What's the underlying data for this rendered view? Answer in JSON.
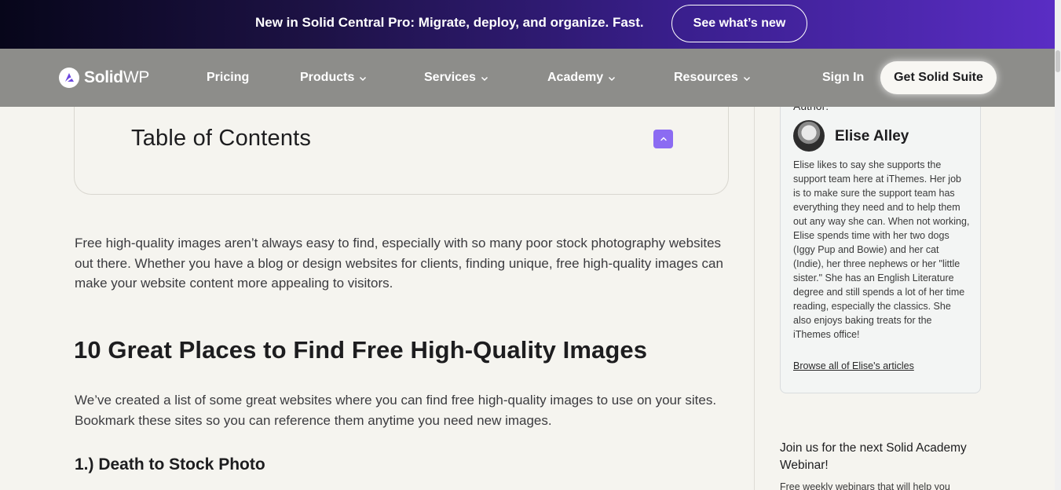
{
  "promo": {
    "text": "New in Solid Central Pro: Migrate, deploy, and organize. Fast.",
    "button": "See what’s new"
  },
  "nav": {
    "logo_bold": "Solid",
    "logo_light": "WP",
    "items": [
      {
        "label": "Pricing"
      },
      {
        "label": "Products"
      },
      {
        "label": "Services"
      },
      {
        "label": "Academy"
      },
      {
        "label": "Resources"
      }
    ],
    "signin": "Sign In",
    "cta": "Get Solid Suite"
  },
  "toc": {
    "title": "Table of Contents"
  },
  "article": {
    "intro": "Free high-quality images aren’t always easy to find, especially with so many poor stock photography websites out there. Whether you have a blog or design websites for clients, finding unique, free high-quality images can make your website content more appealing to visitors.",
    "heading": "10 Great Places to Find Free High-Quality Images",
    "list_intro": "We’ve created a list of some great websites where you can find free high-quality images to use on your sites. Bookmark these sites so you can reference them anytime you need new images.",
    "item1_heading": "1.)  Death to Stock Photo"
  },
  "author": {
    "label": "Author:",
    "name": "Elise Alley",
    "bio": "Elise likes to say she supports the support team here at iThemes. Her job is to make sure the support team has everything they need and to help them out any way she can. When not working, Elise spends time with her two dogs (Iggy Pup and Bowie) and her cat (Indie), her three nephews or her \"little sister.\" She has an English Literature degree and still spends a lot of her time reading, especially the classics. She also enjoys baking treats for the iThemes office!",
    "link": "Browse all of Elise's articles"
  },
  "sidebar": {
    "webinar_title": "Join us for the next Solid Academy Webinar!",
    "webinar_sub": "Free weekly webinars that will help you"
  },
  "colors": {
    "accent": "#8b6bf2",
    "nav_bg": "#8d8d8a",
    "page_bg": "#f5f4ef"
  }
}
